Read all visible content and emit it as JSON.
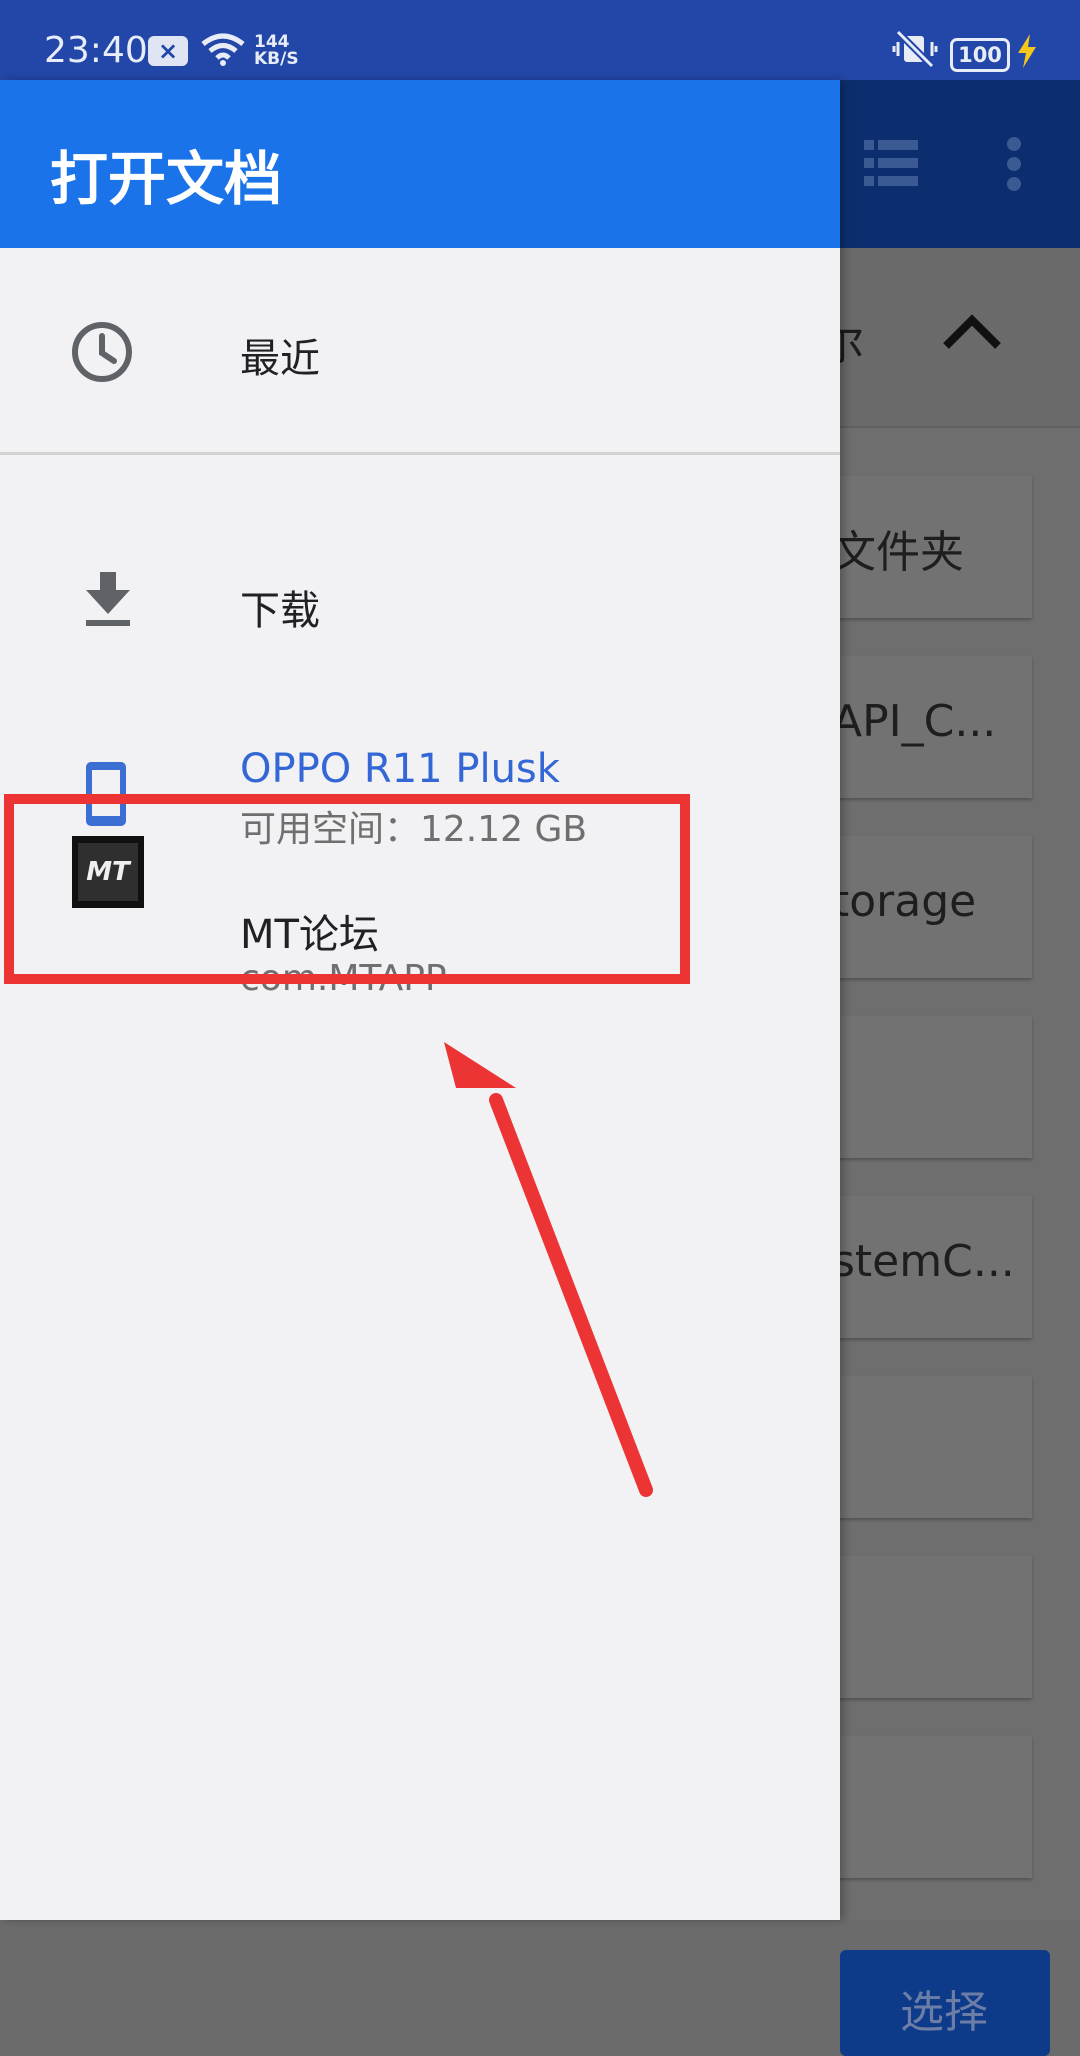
{
  "status_bar": {
    "time": "23:40",
    "net_speed_value": "144",
    "net_speed_unit": "KB/S",
    "battery": "100",
    "icons": [
      "notification-icon",
      "wifi-icon",
      "mute-vibrate-icon",
      "battery-icon",
      "charging-icon"
    ]
  },
  "drawer": {
    "title": "打开文档",
    "items": [
      {
        "label": "最近",
        "icon": "clock-icon"
      },
      {
        "label": "下载",
        "icon": "download-icon"
      },
      {
        "label": "OPPO R11 Plusk",
        "subtitle": "可用空间：12.12 GB",
        "icon": "phone-icon",
        "label_color": "#3367d6"
      },
      {
        "label": "MT论坛",
        "subtitle": "com.MTAPP",
        "icon": "mt-app-icon",
        "logo_text": "MT"
      }
    ]
  },
  "background": {
    "header_fragment": "尔",
    "cards": [
      "文件夹",
      "API_C...",
      "torage",
      "",
      "stemC...",
      "",
      "",
      ""
    ],
    "select_button": "选择",
    "icons": [
      "list-view-icon",
      "more-vert-icon",
      "chevron-up-icon"
    ]
  },
  "annotation": {
    "highlight_color": "#ec3434"
  }
}
